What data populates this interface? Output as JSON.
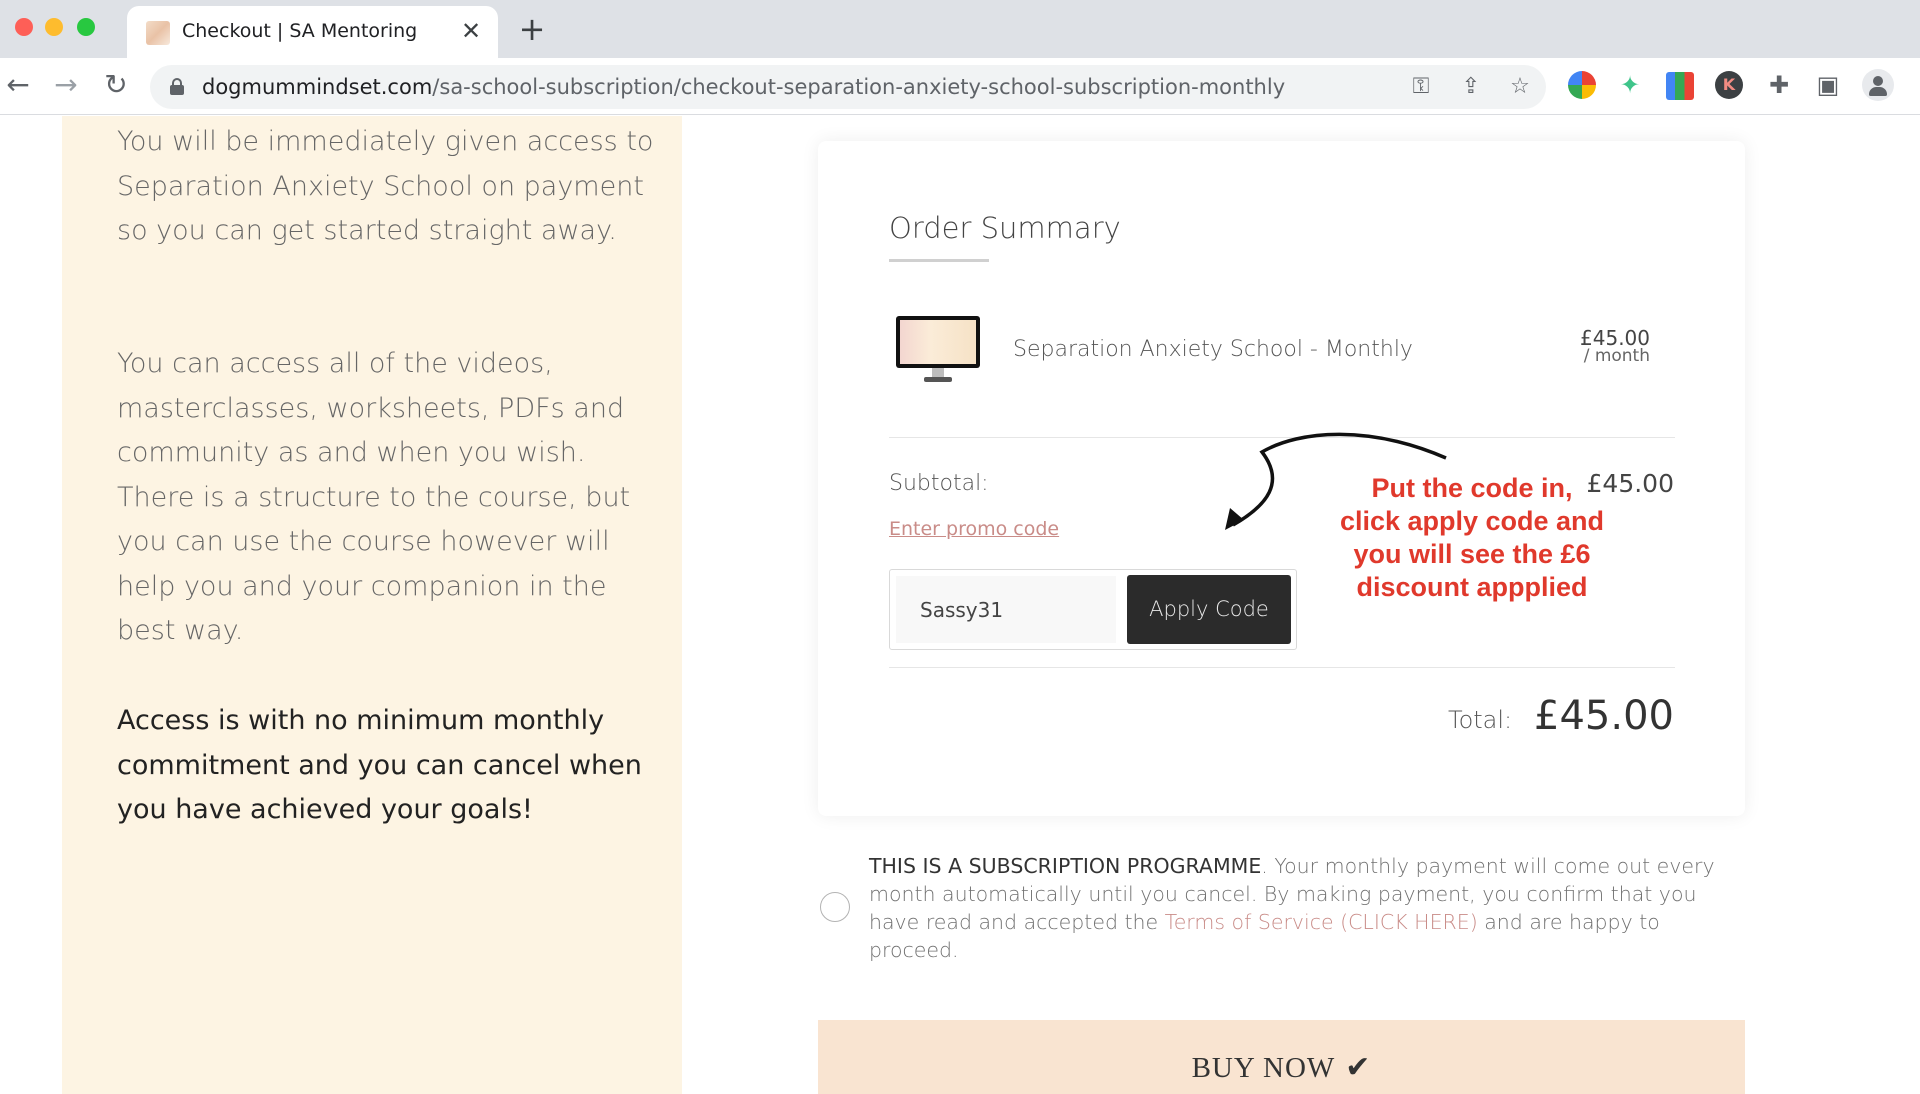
{
  "browser": {
    "tab_title": "Checkout | SA Mentoring",
    "url_host": "dogmummindset.com",
    "url_path": "/sa-school-subscription/checkout-separation-anxiety-school-subscription-monthly",
    "extension_k_label": "K"
  },
  "left_panel": {
    "para1": "You will be immediately given access to Separation Anxiety School on payment so you can get started straight away.",
    "para2": "You can access all of the videos, masterclasses, worksheets, PDFs and community as and when you wish. There is a structure to the course, but you can use the course however will help you and your companion in the best way.",
    "para3": "Access is with no minimum monthly commitment and you can cancel when you have achieved your goals!"
  },
  "order": {
    "title": "Order Summary",
    "product_name": "Separation Anxiety School - Monthly",
    "product_price": "£45.00",
    "product_period": "/ month",
    "subtotal_label": "Subtotal:",
    "subtotal_value": "£45.00",
    "promo_link": "Enter promo code",
    "promo_value": "Sassy31",
    "apply_label": "Apply Code",
    "total_label": "Total:",
    "total_value": "£45.00"
  },
  "annotation": {
    "text": "Put the code in, click apply code and you will see the £6 discount appplied",
    "color": "#e0392c"
  },
  "subscription": {
    "strong": "THIS IS A SUBSCRIPTION PROGRAMME",
    "text_before": ". Your monthly payment will come out every month automatically until you cancel. By making payment, you confirm that you have read and accepted the ",
    "tos_link": "Terms of Service (CLICK HERE)",
    "text_after": " and are happy to proceed."
  },
  "buy": {
    "label": "BUY NOW"
  }
}
